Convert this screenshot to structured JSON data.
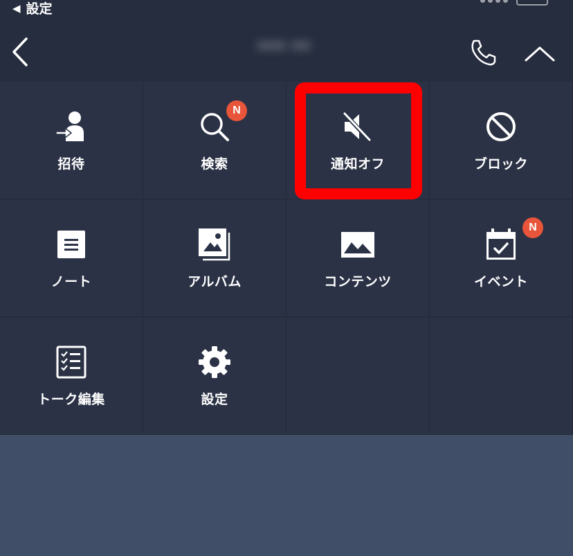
{
  "status_bar": {
    "back_label": "設定",
    "back_arrow": "◀"
  },
  "header": {
    "title": "••• ••"
  },
  "menu": [
    {
      "label": "招待",
      "icon": "add-friend-icon",
      "badge": ""
    },
    {
      "label": "検索",
      "icon": "search-icon",
      "badge": "N"
    },
    {
      "label": "通知オフ",
      "icon": "speaker-mute-icon",
      "badge": ""
    },
    {
      "label": "ブロック",
      "icon": "block-icon",
      "badge": ""
    },
    {
      "label": "ノート",
      "icon": "note-icon",
      "badge": ""
    },
    {
      "label": "アルバム",
      "icon": "album-icon",
      "badge": ""
    },
    {
      "label": "コンテンツ",
      "icon": "image-icon",
      "badge": ""
    },
    {
      "label": "イベント",
      "icon": "calendar-icon",
      "badge": "N"
    },
    {
      "label": "トーク編集",
      "icon": "checklist-icon",
      "badge": ""
    },
    {
      "label": "設定",
      "icon": "gear-icon",
      "badge": ""
    }
  ],
  "colors": {
    "header_bg": "#262d3e",
    "menu_bg": "#2b3245",
    "badge": "#e8553b",
    "highlight": "#ff0000",
    "background": "#404e68"
  }
}
